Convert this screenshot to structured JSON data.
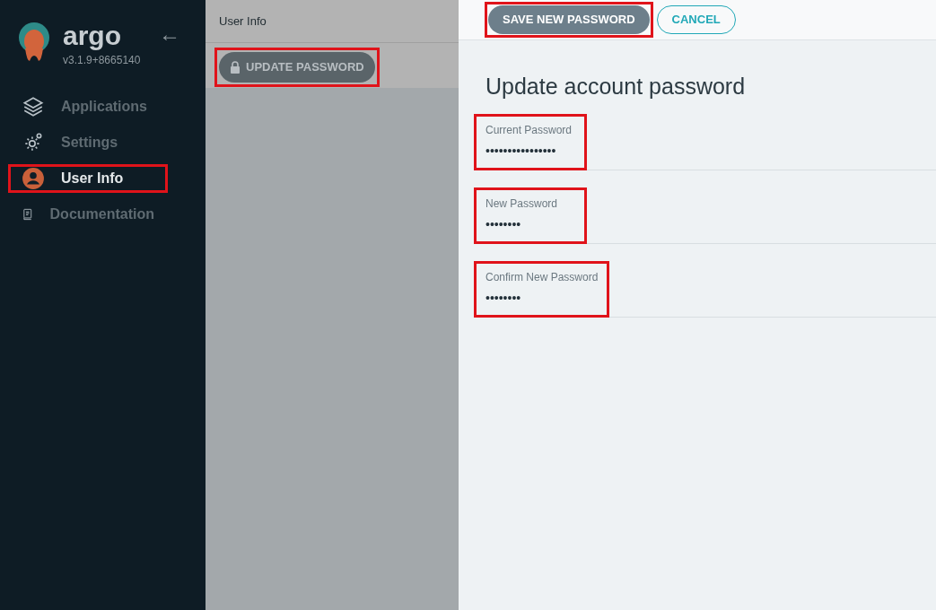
{
  "sidebar": {
    "brand": "argo",
    "version": "v3.1.9+8665140",
    "back_arrow": "←",
    "items": [
      {
        "kind": "layers",
        "label": "Applications",
        "selected": false,
        "highlighted": false
      },
      {
        "kind": "gear",
        "label": "Settings",
        "selected": false,
        "highlighted": false
      },
      {
        "kind": "user",
        "label": "User Info",
        "selected": true,
        "highlighted": true
      },
      {
        "kind": "book",
        "label": "Documentation",
        "selected": false,
        "highlighted": false
      }
    ]
  },
  "middle": {
    "title": "User Info",
    "action": {
      "label": "UPDATE PASSWORD",
      "highlighted": true
    }
  },
  "toolbar": {
    "buttons": [
      {
        "kind": "primary",
        "label": "SAVE NEW PASSWORD",
        "highlighted": true
      },
      {
        "kind": "outline",
        "label": "CANCEL",
        "highlighted": false
      }
    ]
  },
  "form": {
    "title": "Update account password",
    "fields": [
      {
        "label": "Current Password",
        "value": "••••••••••••••••",
        "highlighted": true
      },
      {
        "label": "New Password",
        "value": "••••••••",
        "highlighted": true
      },
      {
        "label": "Confirm New Password",
        "value": "••••••••",
        "highlighted": true
      }
    ]
  }
}
